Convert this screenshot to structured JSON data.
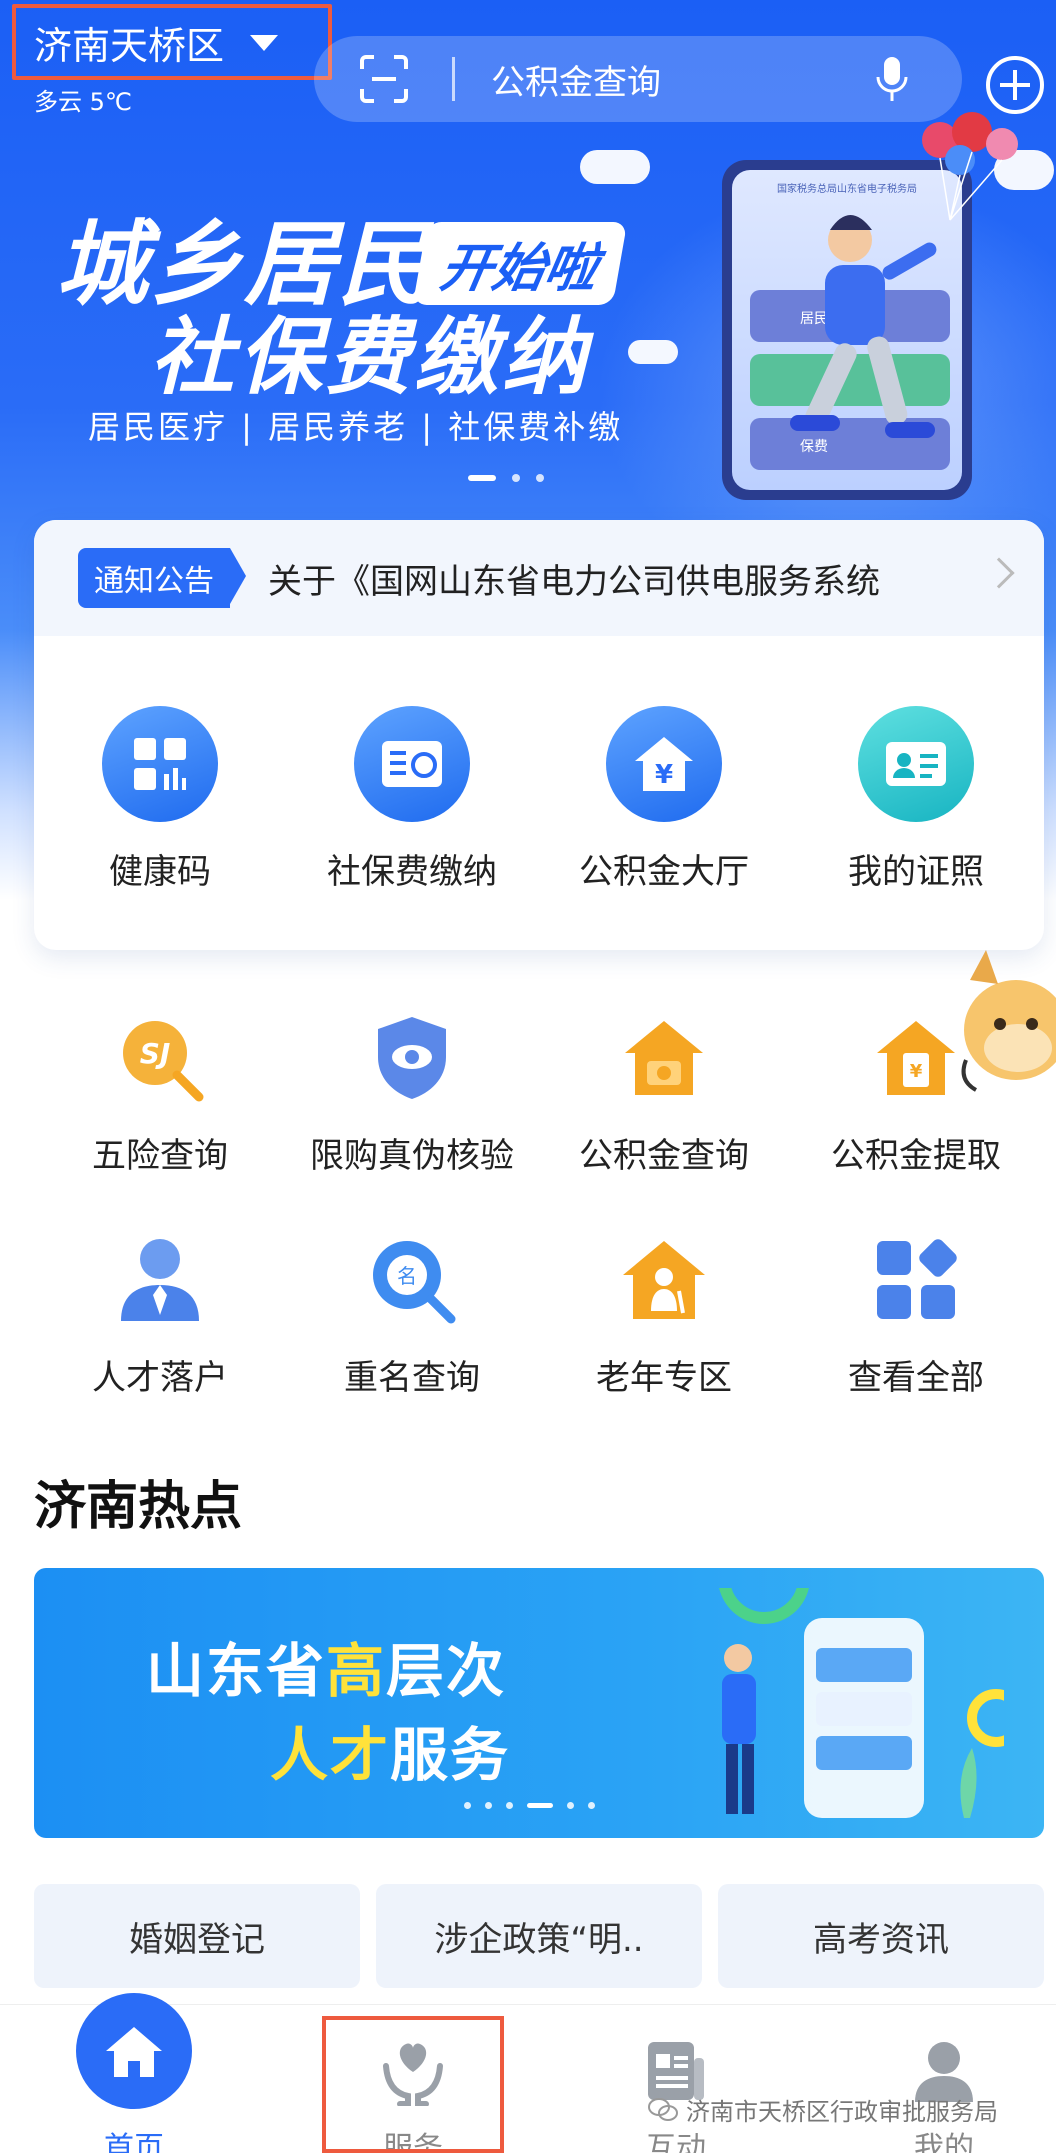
{
  "header": {
    "city": "济南天桥区",
    "weather": "多云 5℃",
    "search_placeholder": "公积金查询"
  },
  "banner": {
    "title_line1": "城乡居民",
    "badge": "开始啦",
    "title_line2": "社保费缴纳",
    "subtitle": "居民医疗 | 居民养老 | 社保费补缴",
    "phone_header": "国家税务总局山东省电子税务局",
    "phone_rows": [
      "居民医",
      "",
      "保费"
    ]
  },
  "notice": {
    "tag": "通知公告",
    "text": "关于《国网山东省电力公司供电服务系统"
  },
  "main_services": [
    {
      "label": "健康码",
      "icon": "grid-icon"
    },
    {
      "label": "社保费缴纳",
      "icon": "social-security-card-icon"
    },
    {
      "label": "公积金大厅",
      "icon": "house-yuan-icon"
    },
    {
      "label": "我的证照",
      "icon": "id-card-icon"
    }
  ],
  "services_row2": [
    {
      "label": "五险查询",
      "icon": "insurance-search-icon"
    },
    {
      "label": "限购真伪核验",
      "icon": "shield-eye-icon"
    },
    {
      "label": "公积金查询",
      "icon": "fund-house-icon"
    },
    {
      "label": "公积金提取",
      "icon": "fund-withdraw-icon"
    }
  ],
  "services_row3": [
    {
      "label": "人才落户",
      "icon": "talent-person-icon"
    },
    {
      "label": "重名查询",
      "icon": "name-search-icon"
    },
    {
      "label": "老年专区",
      "icon": "elderly-house-icon"
    },
    {
      "label": "查看全部",
      "icon": "all-apps-icon"
    }
  ],
  "hot": {
    "title": "济南热点",
    "banner_line1_a": "山东省",
    "banner_line1_b": "高",
    "banner_line1_c": "层次",
    "banner_line2_a": "人才",
    "banner_line2_b": "服务"
  },
  "quick_links": [
    "婚姻登记",
    "涉企政策“明..",
    "高考资讯"
  ],
  "tabs": [
    "首页",
    "服务",
    "互动",
    "我的"
  ],
  "watermark": "济南市天桥区行政审批服务局",
  "colors": {
    "primary": "#2a6cf7",
    "highlight_box": "#ee5a3e",
    "accent_yellow": "#ffe23a",
    "orange": "#f5a623"
  }
}
